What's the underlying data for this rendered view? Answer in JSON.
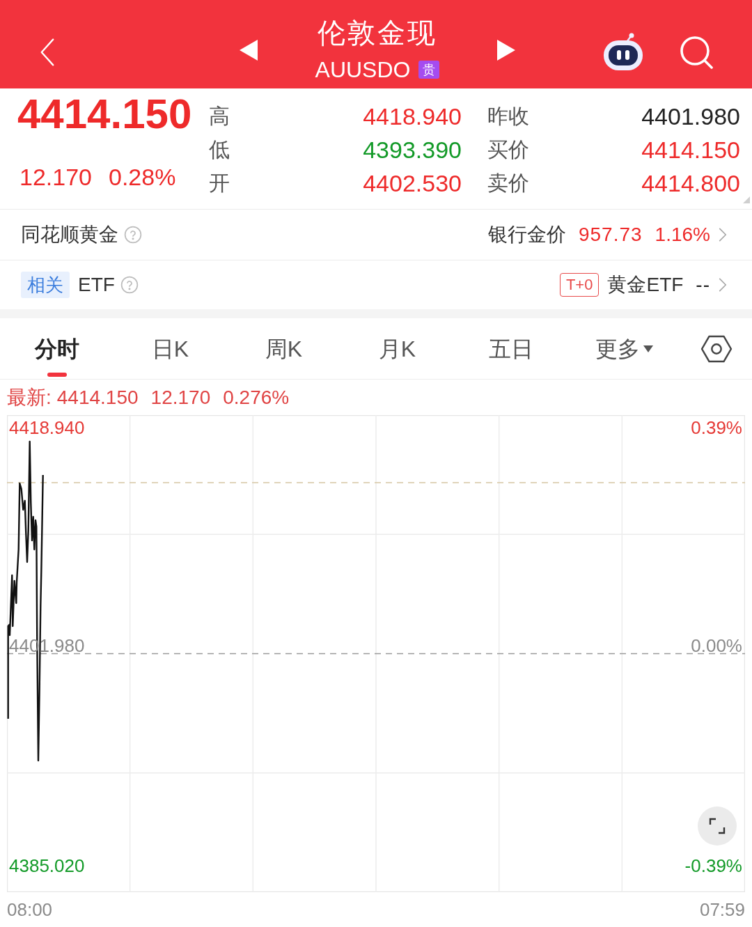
{
  "header": {
    "title": "伦敦金现",
    "code": "AUUSDO",
    "badge": "贵"
  },
  "quote": {
    "price": "4414.150",
    "change": "12.170",
    "change_pct": "0.28%",
    "color": "#ee2a2a",
    "stats": [
      {
        "label": "高",
        "value": "4418.940",
        "color": "#ee2a2a"
      },
      {
        "label": "昨收",
        "value": "4401.980",
        "color": "#222222"
      },
      {
        "label": "低",
        "value": "4393.390",
        "color": "#139a28"
      },
      {
        "label": "买价",
        "value": "4414.150",
        "color": "#ee2a2a"
      },
      {
        "label": "开",
        "value": "4402.530",
        "color": "#ee2a2a"
      },
      {
        "label": "卖价",
        "value": "4414.800",
        "color": "#ee2a2a"
      }
    ]
  },
  "info_rows": [
    {
      "title": "同花顺黄金",
      "label": "银行金价",
      "value": "957.73",
      "change_pct": "1.16%",
      "color": "#ee2a2a"
    },
    {
      "tag": "相关",
      "title": "ETF",
      "badge": "T+0",
      "label": "黄金ETF",
      "value": "--",
      "color": "#222222"
    }
  ],
  "tabs": [
    {
      "label": "分时",
      "selected": true,
      "kind": "tab"
    },
    {
      "label": "日K",
      "selected": false,
      "kind": "tab"
    },
    {
      "label": "周K",
      "selected": false,
      "kind": "tab"
    },
    {
      "label": "月K",
      "selected": false,
      "kind": "tab"
    },
    {
      "label": "五日",
      "selected": false,
      "kind": "tab"
    },
    {
      "label": "更多",
      "selected": false,
      "kind": "menu"
    }
  ],
  "chart": {
    "latest": {
      "label": "最新:",
      "price": "4414.150",
      "change": "12.170",
      "change_pct": "0.276%"
    },
    "axis_rows": [
      {
        "price": "4418.940",
        "percent": "0.39%",
        "color": "#e53935"
      },
      {
        "price": "4401.980",
        "percent": "0.00%",
        "color": "#8a8a8a"
      },
      {
        "price": "4385.020",
        "percent": "-0.39%",
        "color": "#139a28"
      }
    ],
    "time_labels": [
      "08:00",
      "07:59"
    ]
  }
}
